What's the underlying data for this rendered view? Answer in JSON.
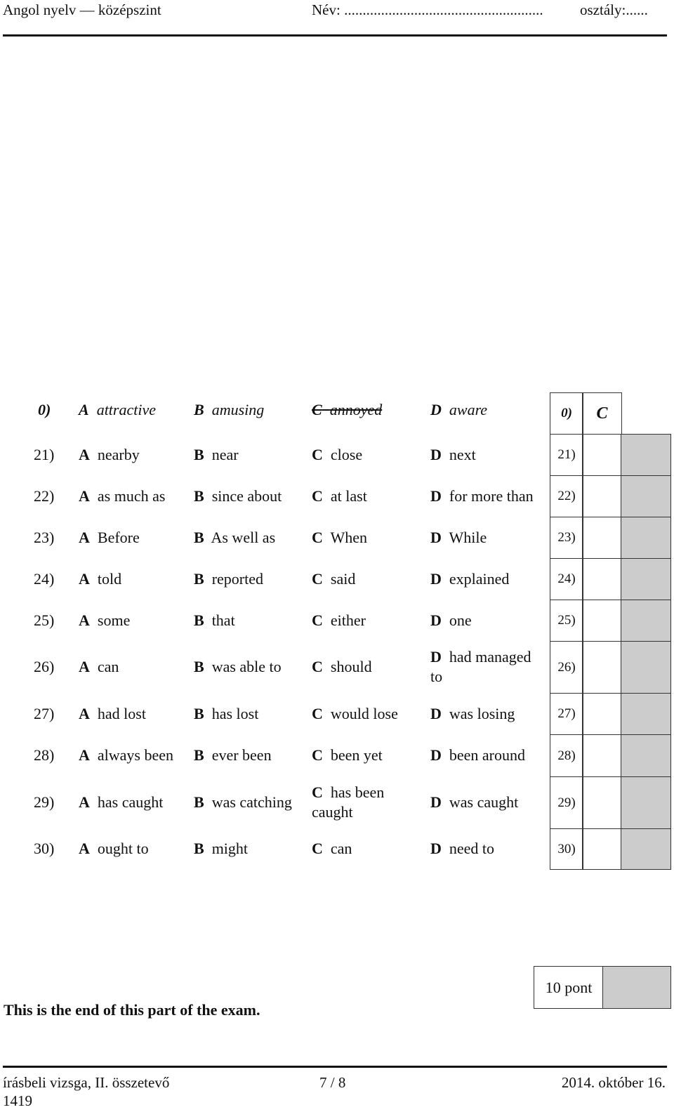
{
  "header": {
    "left": "Angol nyelv — középszint",
    "name_field": "Név: ......................................................",
    "class_field": "osztály:......"
  },
  "example": {
    "num": "0)",
    "options": [
      {
        "letter": "A",
        "text": "attractive",
        "crossed": false
      },
      {
        "letter": "B",
        "text": "amusing",
        "crossed": false
      },
      {
        "letter": "C",
        "text": "annoyed",
        "crossed": true
      },
      {
        "letter": "D",
        "text": "aware",
        "crossed": false
      }
    ],
    "answer": "C"
  },
  "questions": [
    {
      "num": "21)",
      "A": "nearby",
      "B": "near",
      "C": "close",
      "D": "next"
    },
    {
      "num": "22)",
      "A": "as much as",
      "B": "since about",
      "C": "at last",
      "D": "for more than"
    },
    {
      "num": "23)",
      "A": "Before",
      "B": "As well as",
      "C": "When",
      "D": "While"
    },
    {
      "num": "24)",
      "A": "told",
      "B": "reported",
      "C": "said",
      "D": "explained"
    },
    {
      "num": "25)",
      "A": "some",
      "B": "that",
      "C": "either",
      "D": "one"
    },
    {
      "num": "26)",
      "A": "can",
      "B": "was able to",
      "C": "should",
      "D": "had managed to"
    },
    {
      "num": "27)",
      "A": "had lost",
      "B": "has lost",
      "C": "would lose",
      "D": "was losing"
    },
    {
      "num": "28)",
      "A": "always been",
      "B": "ever been",
      "C": "been yet",
      "D": "been around"
    },
    {
      "num": "29)",
      "A": "has caught",
      "B": "was catching",
      "C": "has been caught",
      "D": "was caught"
    },
    {
      "num": "30)",
      "A": "ought to",
      "B": "might",
      "C": "can",
      "D": "need to"
    }
  ],
  "letters": {
    "A": "A",
    "B": "B",
    "C": "C",
    "D": "D"
  },
  "end_text": "This is the end of this part of the exam.",
  "score_box": {
    "label": "10 pont"
  },
  "footer": {
    "left": "írásbeli vizsga, II. összetevő",
    "code": "1419",
    "page": "7 / 8",
    "date": "2014. október 16."
  }
}
